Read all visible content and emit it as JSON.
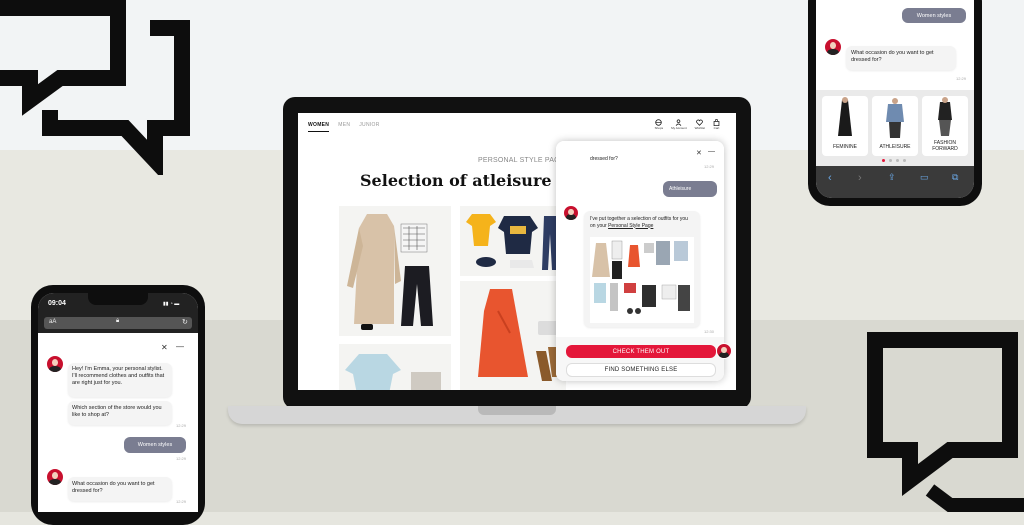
{
  "laptop": {
    "nav": {
      "women": "WOMEN",
      "men": "MEN",
      "junior": "JUNIOR"
    },
    "nav_icons": [
      "Shops",
      "My Account",
      "Wishlist",
      "Cart"
    ],
    "personal_style_label": "PERSONAL STYLE PAGE",
    "page_title": "Selection of atleisure o",
    "chat": {
      "prev_msg": "dressed for?",
      "prev_time": "12:29",
      "user_reply": "Athleisure",
      "bot_msg": "I've put together a selection of outfits for you on your ",
      "bot_link": "Personal Style Page",
      "bot_time": "12:30",
      "btn_check": "CHECK THEM OUT",
      "btn_find": "FIND SOMETHING ELSE",
      "close": "✕",
      "minimize": "—"
    }
  },
  "phone_left": {
    "time": "09:04",
    "url": "aA",
    "close": "✕",
    "minimize": "—",
    "msg1": "Hey! I'm Emma, your personal stylist. I'll recommend clothes and outfits that are right just for you.",
    "msg2": "Which section of the store would you like to shop at?",
    "time1": "12:29",
    "user_reply": "Women styles",
    "time2": "12:29",
    "msg3": "What occasion do you want to get dressed for?",
    "time3": "12:29"
  },
  "phone_right": {
    "user_reply": "Women styles",
    "bot_msg": "What occasion do you want to get dressed for?",
    "time": "12:29",
    "options": [
      "FEMININE",
      "ATHLEISURE",
      "FASHION FORWARD"
    ]
  },
  "colors": {
    "accent_red": "#e4173a",
    "user_bubble": "#7a7d91",
    "dark": "#111111"
  }
}
